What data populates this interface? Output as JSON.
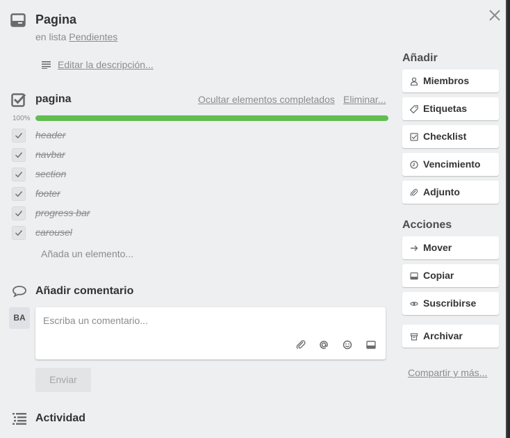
{
  "card": {
    "title": "Pagina",
    "list_prefix": "en lista ",
    "list_name": "Pendientes",
    "edit_description": "Editar la descripción..."
  },
  "checklist": {
    "title": "pagina",
    "hide_completed": "Ocultar elementos completados",
    "delete": "Eliminar...",
    "progress_label": "100%",
    "progress": 1.0,
    "items": [
      {
        "label": "header",
        "done": true
      },
      {
        "label": "navbar",
        "done": true
      },
      {
        "label": "section",
        "done": true
      },
      {
        "label": "footer",
        "done": true
      },
      {
        "label": "progress bar",
        "done": true
      },
      {
        "label": "carousel",
        "done": true
      }
    ],
    "add_item": "Añada un elemento..."
  },
  "comment": {
    "title": "Añadir comentario",
    "avatar_initials": "BA",
    "placeholder": "Escriba un comentario...",
    "send": "Enviar",
    "icons": [
      "paperclip-icon",
      "at-sign-icon",
      "emoji-icon",
      "card-icon"
    ]
  },
  "activity": {
    "title": "Actividad"
  },
  "sidebar": {
    "add_heading": "Añadir",
    "add_buttons": [
      {
        "label": "Miembros",
        "icon": "person-icon"
      },
      {
        "label": "Etiquetas",
        "icon": "tag-icon"
      },
      {
        "label": "Checklist",
        "icon": "checkbox-icon"
      },
      {
        "label": "Vencimiento",
        "icon": "clock-icon"
      },
      {
        "label": "Adjunto",
        "icon": "paperclip-icon"
      }
    ],
    "actions_heading": "Acciones",
    "action_buttons": [
      {
        "label": "Mover",
        "icon": "arrow-right-icon"
      },
      {
        "label": "Copiar",
        "icon": "card-icon"
      },
      {
        "label": "Suscribirse",
        "icon": "eye-icon"
      },
      {
        "label": "Archivar",
        "icon": "archive-icon"
      }
    ],
    "share": "Compartir y más..."
  },
  "colors": {
    "progress_fill": "#61bd4f",
    "background": "#edeff0"
  }
}
